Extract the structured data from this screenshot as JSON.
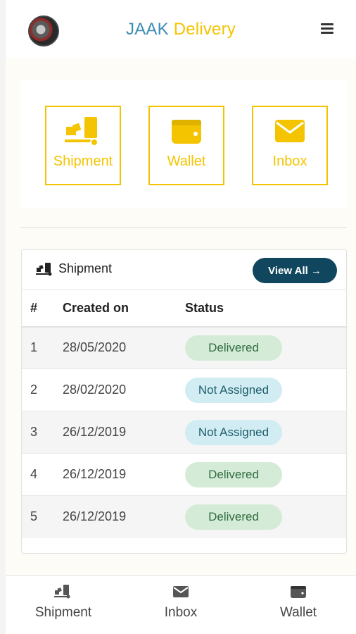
{
  "header": {
    "brand_part1": "JAAK",
    "brand_part2": "Delivery",
    "menu_icon": "hamburger-icon",
    "avatar_icon": "profile-avatar"
  },
  "tiles": [
    {
      "label": "Shipment",
      "icon": "truck-icon"
    },
    {
      "label": "Wallet",
      "icon": "wallet-icon"
    },
    {
      "label": "Inbox",
      "icon": "envelope-icon"
    }
  ],
  "shipment_card": {
    "title": "Shipment",
    "view_all_label": "View All",
    "view_all_arrow": "→",
    "columns": [
      "#",
      "Created on",
      "Status"
    ],
    "rows": [
      {
        "num": "1",
        "created": "28/05/2020",
        "status": "Delivered"
      },
      {
        "num": "2",
        "created": "28/02/2020",
        "status": "Not Assigned"
      },
      {
        "num": "3",
        "created": "26/12/2019",
        "status": "Not Assigned"
      },
      {
        "num": "4",
        "created": "26/12/2019",
        "status": "Delivered"
      },
      {
        "num": "5",
        "created": "26/12/2019",
        "status": "Delivered"
      }
    ]
  },
  "bottom_nav": [
    {
      "label": "Shipment",
      "icon": "truck-icon"
    },
    {
      "label": "Inbox",
      "icon": "envelope-icon"
    },
    {
      "label": "Wallet",
      "icon": "wallet-icon"
    }
  ],
  "colors": {
    "brand_blue": "#3b8db5",
    "brand_yellow": "#f5c400",
    "button_dark": "#10475e",
    "delivered_bg": "#d4ecd7",
    "not_assigned_bg": "#d1ecf2"
  }
}
